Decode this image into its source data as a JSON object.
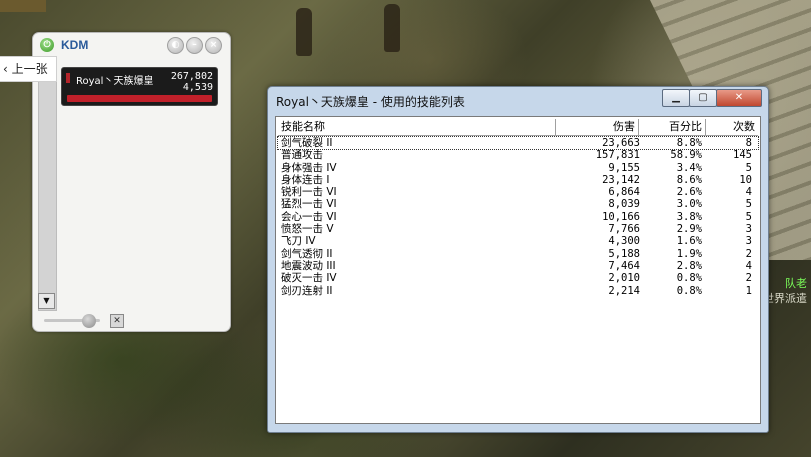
{
  "kdm": {
    "title": "KDM",
    "prev_label": "上一张",
    "card": {
      "name": "Royal丶天族爆皇",
      "total_damage": "267,802",
      "dps": "4,539"
    }
  },
  "window": {
    "title": "Royal丶天族爆皇 - 使用的技能列表",
    "columns": [
      "技能名称",
      "伤害",
      "百分比",
      "次数"
    ],
    "rows": [
      {
        "name": "剑气破裂 II",
        "damage": "23,663",
        "percent": "8.8%",
        "count": "8"
      },
      {
        "name": "普通攻击",
        "damage": "157,831",
        "percent": "58.9%",
        "count": "145"
      },
      {
        "name": "身体强击 IV",
        "damage": "9,155",
        "percent": "3.4%",
        "count": "5"
      },
      {
        "name": "身体连击 I",
        "damage": "23,142",
        "percent": "8.6%",
        "count": "10"
      },
      {
        "name": "锐利一击 VI",
        "damage": "6,864",
        "percent": "2.6%",
        "count": "4"
      },
      {
        "name": "猛烈一击 VI",
        "damage": "8,039",
        "percent": "3.0%",
        "count": "5"
      },
      {
        "name": "会心一击 VI",
        "damage": "10,166",
        "percent": "3.8%",
        "count": "5"
      },
      {
        "name": "愤怒一击 V",
        "damage": "7,766",
        "percent": "2.9%",
        "count": "3"
      },
      {
        "name": "飞刀 IV",
        "damage": "4,300",
        "percent": "1.6%",
        "count": "3"
      },
      {
        "name": "剑气透彻 II",
        "damage": "5,188",
        "percent": "1.9%",
        "count": "2"
      },
      {
        "name": "地震波动 III",
        "damage": "7,464",
        "percent": "2.8%",
        "count": "4"
      },
      {
        "name": "破灭一击 IV",
        "damage": "2,010",
        "percent": "0.8%",
        "count": "2"
      },
      {
        "name": "剑刃连射 II",
        "damage": "2,214",
        "percent": "0.8%",
        "count": "1"
      }
    ]
  },
  "background_chat": [
    "队老",
    "世界派遣"
  ],
  "icons": {
    "power": "power-icon",
    "minimize": "minimize-icon",
    "maximize": "maximize-icon",
    "close": "close-icon",
    "prev": "chevron-left-icon"
  }
}
